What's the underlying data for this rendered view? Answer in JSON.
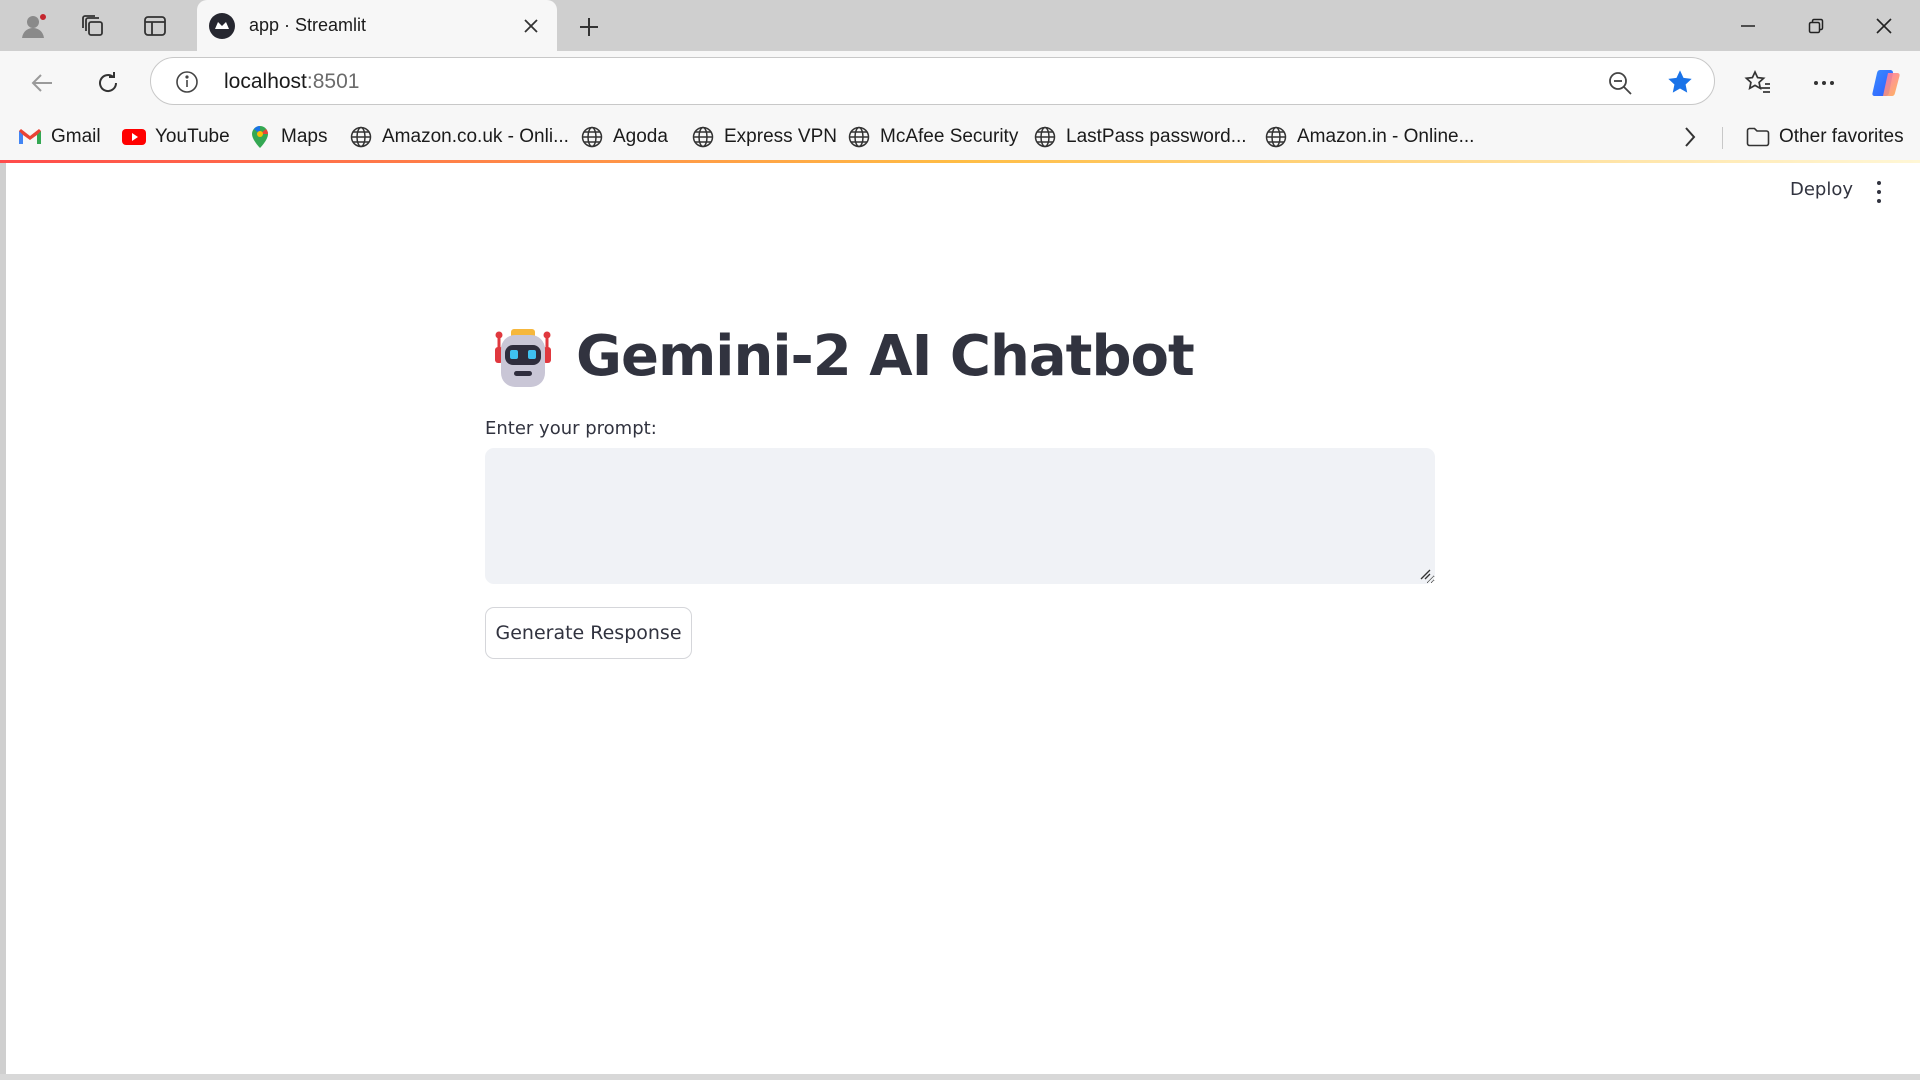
{
  "browser": {
    "tab": {
      "title": "app · Streamlit"
    },
    "address": {
      "host": "localhost",
      "port": ":8501"
    },
    "bookmarks": [
      {
        "label": "Gmail",
        "icon": "gmail-icon"
      },
      {
        "label": "YouTube",
        "icon": "youtube-icon"
      },
      {
        "label": "Maps",
        "icon": "maps-icon"
      },
      {
        "label": "Amazon.co.uk - Onli...",
        "icon": "globe-icon"
      },
      {
        "label": "Agoda",
        "icon": "globe-icon"
      },
      {
        "label": "Express VPN",
        "icon": "globe-icon"
      },
      {
        "label": "McAfee Security",
        "icon": "globe-icon"
      },
      {
        "label": "LastPass password...",
        "icon": "globe-icon"
      },
      {
        "label": "Amazon.in - Online...",
        "icon": "globe-icon"
      }
    ],
    "other_favorites": "Other favorites"
  },
  "app": {
    "toolbar": {
      "deploy_label": "Deploy"
    },
    "title": "Gemini-2 AI Chatbot",
    "title_icon": "robot-icon",
    "prompt": {
      "label": "Enter your prompt:",
      "value": "",
      "placeholder": ""
    },
    "button": {
      "generate_label": "Generate Response"
    }
  },
  "colors": {
    "accent_star": "#1a73e8",
    "text": "#31333f",
    "input_bg": "#f0f2f6",
    "progress_gradient": [
      "#ff4b4b",
      "#ffbd45"
    ]
  }
}
